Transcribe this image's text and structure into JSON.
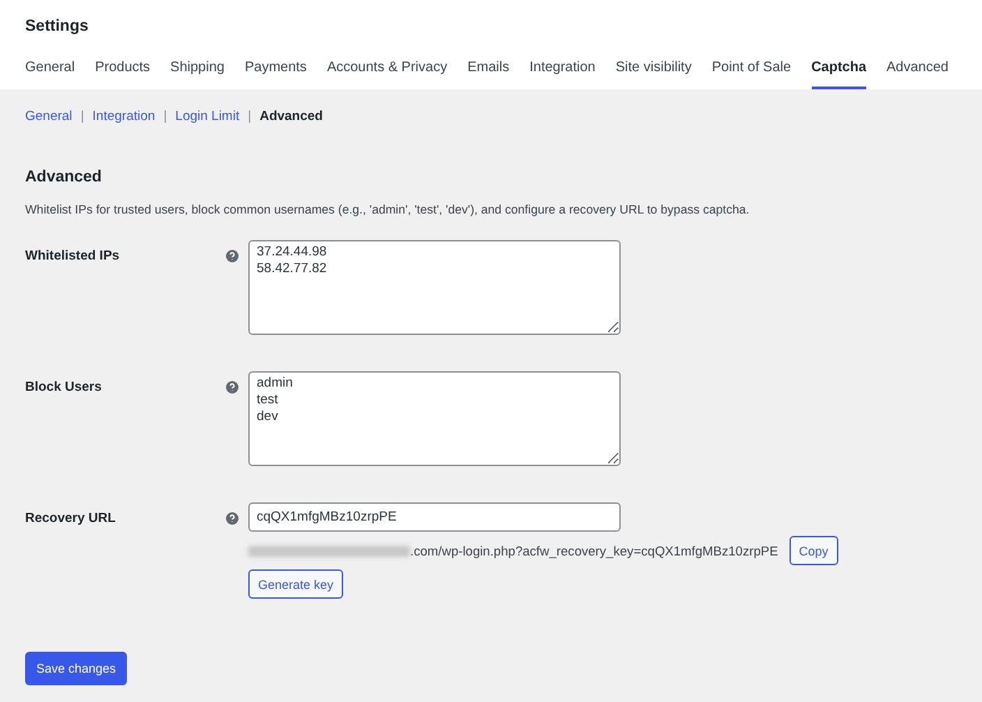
{
  "page_title": "Settings",
  "tabs": [
    {
      "label": "General",
      "selected": false
    },
    {
      "label": "Products",
      "selected": false
    },
    {
      "label": "Shipping",
      "selected": false
    },
    {
      "label": "Payments",
      "selected": false
    },
    {
      "label": "Accounts & Privacy",
      "selected": false
    },
    {
      "label": "Emails",
      "selected": false
    },
    {
      "label": "Integration",
      "selected": false
    },
    {
      "label": "Site visibility",
      "selected": false
    },
    {
      "label": "Point of Sale",
      "selected": false
    },
    {
      "label": "Captcha",
      "selected": true
    },
    {
      "label": "Advanced",
      "selected": false
    }
  ],
  "subnav_separator": "|",
  "subnav": [
    {
      "label": "General",
      "selected": false
    },
    {
      "label": "Integration",
      "selected": false
    },
    {
      "label": "Login Limit",
      "selected": false
    },
    {
      "label": "Advanced",
      "selected": true
    }
  ],
  "section": {
    "heading": "Advanced",
    "description": "Whitelist IPs for trusted users, block common usernames (e.g., 'admin', 'test', 'dev'), and configure a recovery URL to bypass captcha."
  },
  "fields": [
    {
      "kind": "textarea",
      "label": "Whitelisted IPs",
      "value": "37.24.44.98\n58.42.77.82"
    },
    {
      "kind": "textarea",
      "label": "Block Users",
      "value": "admin\ntest\ndev"
    },
    {
      "kind": "recovery",
      "label": "Recovery URL",
      "value": "cqQX1mfgMBz10zrpPE",
      "url_visible": ".com/wp-login.php?acfw_recovery_key=cqQX1mfgMBz10zrpPE",
      "copy_button": "Copy",
      "generate_button": "Generate key"
    }
  ],
  "save_button": "Save changes"
}
